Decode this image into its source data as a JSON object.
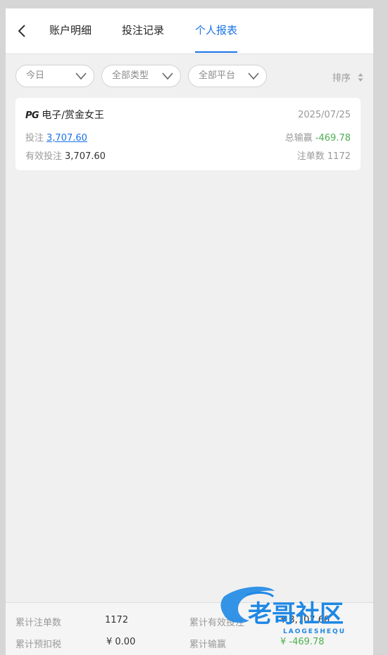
{
  "tabs": [
    {
      "label": "账户明细"
    },
    {
      "label": "投注记录"
    },
    {
      "label": "个人报表"
    }
  ],
  "filters": {
    "date": "今日",
    "type": "全部类型",
    "platform": "全部平台",
    "sort": "排序"
  },
  "record": {
    "logo": "PG",
    "game": "电子/赏金女王",
    "date": "2025/07/25",
    "bet_label": "投注",
    "bet_value": "3,707.60",
    "winloss_label": "总输赢",
    "winloss_value": "-469.78",
    "valid_label": "有效投注",
    "valid_value": "3,707.60",
    "count_label": "注单数",
    "count_value": "1172"
  },
  "summary": {
    "total_count_label": "累计注单数",
    "total_count_value": "1172",
    "total_valid_label": "累计有效投注",
    "total_valid_value": "¥ 3,707.60",
    "total_tax_label": "累计预扣税",
    "total_tax_value": "¥ 0.00",
    "total_winloss_label": "累计输赢",
    "total_winloss_value": "¥ -469.78"
  },
  "watermark": {
    "title": "老哥社区",
    "subtitle": "LAOGESHEQU"
  },
  "colors": {
    "accent": "#1a73e8",
    "positive": "#4caf50",
    "watermark": "#1e88e5"
  }
}
